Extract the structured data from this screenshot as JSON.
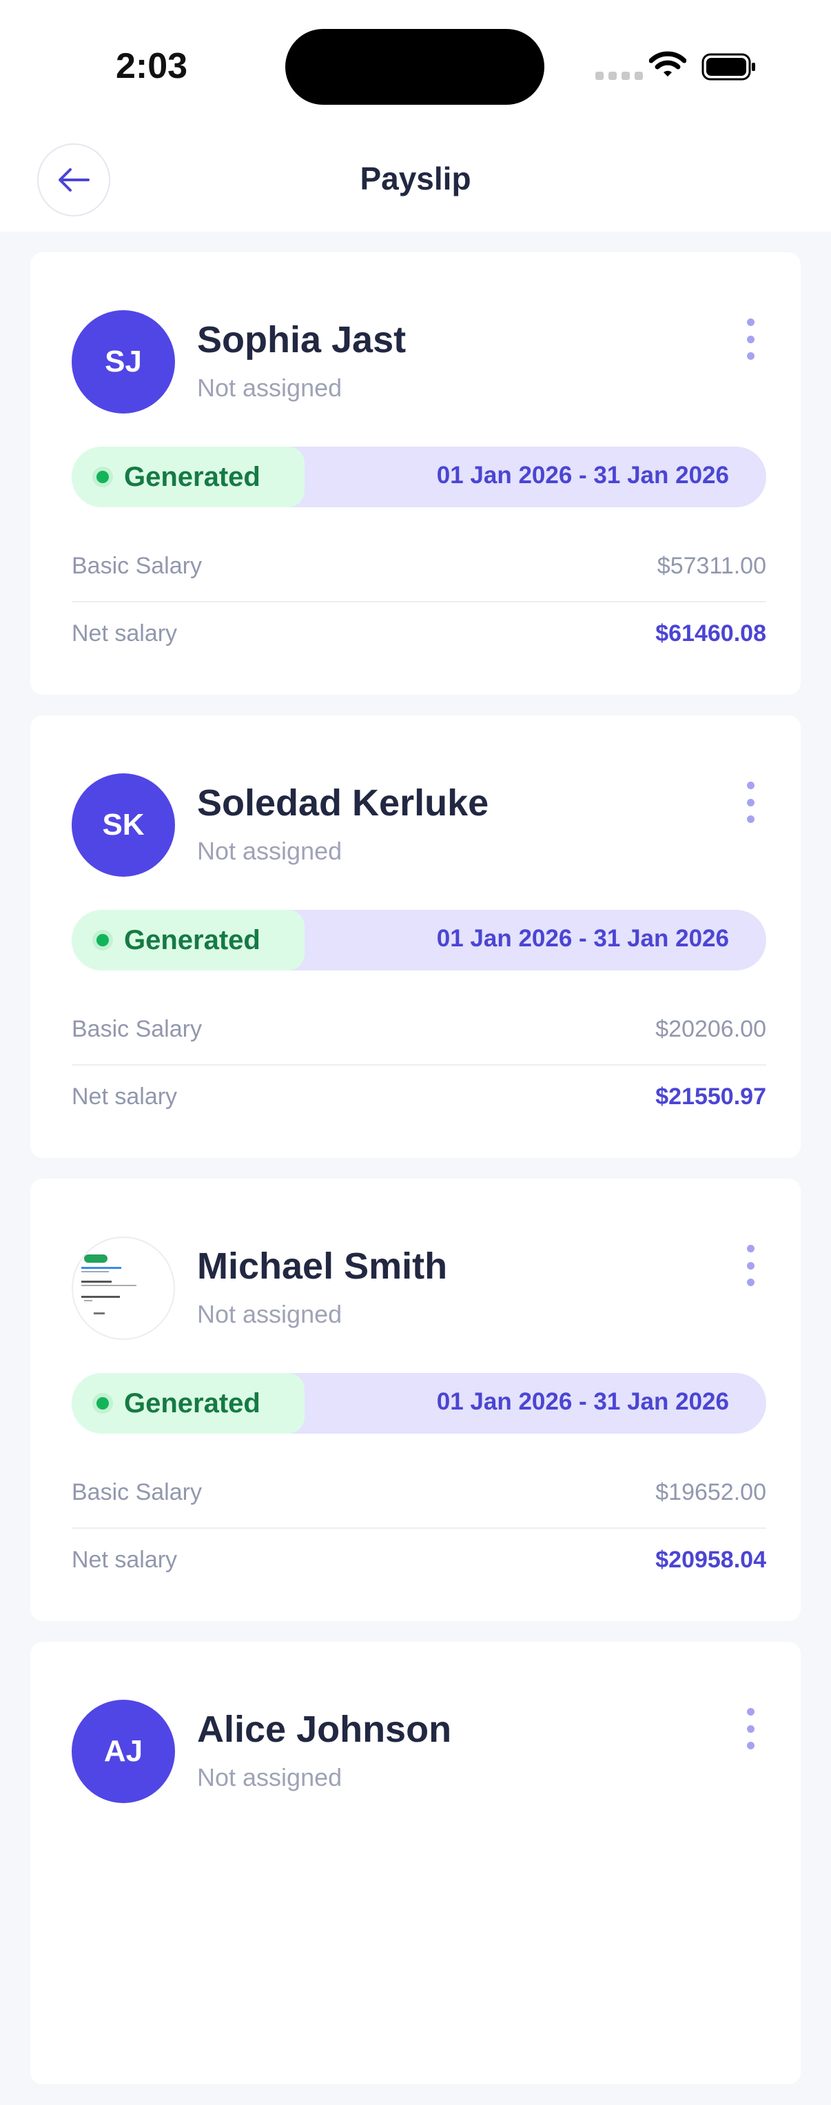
{
  "status_bar": {
    "time": "2:03"
  },
  "header": {
    "title": "Payslip"
  },
  "labels": {
    "basic_salary": "Basic Salary",
    "net_salary": "Net salary"
  },
  "cards": [
    {
      "initials": "SJ",
      "name": "Sophia Jast",
      "role": "Not assigned",
      "status": "Generated",
      "period": "01 Jan 2026 - 31 Jan 2026",
      "basic_salary": "$57311.00",
      "net_salary": "$61460.08"
    },
    {
      "initials": "SK",
      "name": "Soledad Kerluke",
      "role": "Not assigned",
      "status": "Generated",
      "period": "01 Jan 2026 - 31 Jan 2026",
      "basic_salary": "$20206.00",
      "net_salary": "$21550.97"
    },
    {
      "initials": "",
      "name": "Michael Smith",
      "role": "Not assigned",
      "status": "Generated",
      "period": "01 Jan 2026 - 31 Jan 2026",
      "basic_salary": "$19652.00",
      "net_salary": "$20958.04"
    },
    {
      "initials": "AJ",
      "name": "Alice Johnson",
      "role": "Not assigned"
    }
  ],
  "colors": {
    "accent": "#5046e5",
    "status_green": "#12b45a",
    "period_bg": "#e4e2fc",
    "status_bg": "#dcfbe6"
  },
  "icons": {
    "back": "arrow-left-icon",
    "menu": "more-vertical-icon",
    "wifi": "wifi-icon",
    "battery": "battery-icon"
  }
}
